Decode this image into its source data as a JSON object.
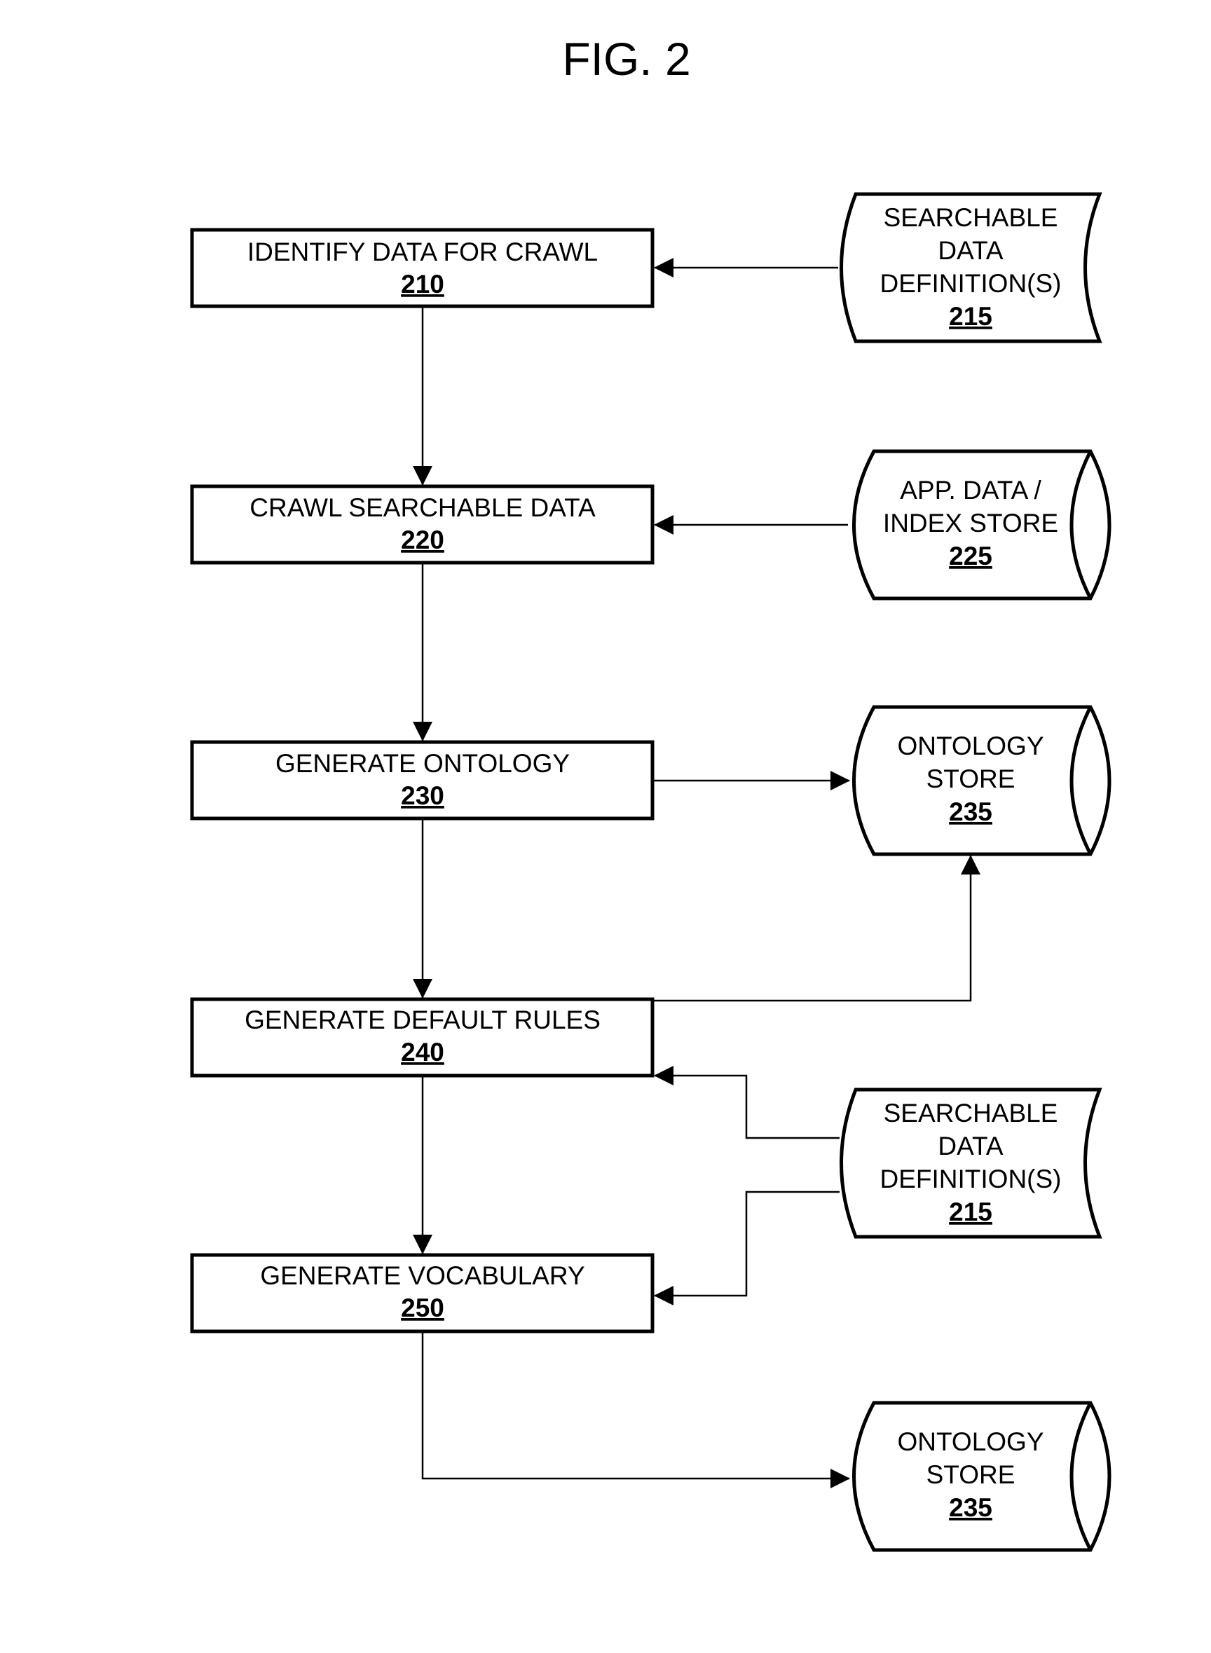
{
  "figure": {
    "title": "FIG. 2"
  },
  "steps": [
    {
      "id": "210",
      "label": "IDENTIFY DATA FOR CRAWL",
      "ref": "210"
    },
    {
      "id": "220",
      "label": "CRAWL SEARCHABLE DATA",
      "ref": "220"
    },
    {
      "id": "230",
      "label": "GENERATE ONTOLOGY",
      "ref": "230"
    },
    {
      "id": "240",
      "label": "GENERATE DEFAULT RULES",
      "ref": "240"
    },
    {
      "id": "250",
      "label": "GENERATE VOCABULARY",
      "ref": "250"
    }
  ],
  "data_sources": [
    {
      "shape": "stored-data",
      "lines": [
        "SEARCHABLE",
        "DATA",
        "DEFINITION(S)"
      ],
      "ref": "215"
    },
    {
      "shape": "cylinder",
      "lines": [
        "APP. DATA /",
        "INDEX STORE"
      ],
      "ref": "225"
    },
    {
      "shape": "cylinder",
      "lines": [
        "ONTOLOGY",
        "STORE"
      ],
      "ref": "235"
    },
    {
      "shape": "stored-data",
      "lines": [
        "SEARCHABLE",
        "DATA",
        "DEFINITION(S)"
      ],
      "ref": "215"
    },
    {
      "shape": "cylinder",
      "lines": [
        "ONTOLOGY",
        "STORE"
      ],
      "ref": "235"
    }
  ],
  "connections": [
    {
      "from": "215",
      "to": "210"
    },
    {
      "from": "210",
      "to": "220"
    },
    {
      "from": "225",
      "to": "220"
    },
    {
      "from": "220",
      "to": "230"
    },
    {
      "from": "230",
      "to": "235"
    },
    {
      "from": "230",
      "to": "240"
    },
    {
      "from": "240",
      "to": "235"
    },
    {
      "from": "215",
      "to": "240"
    },
    {
      "from": "215",
      "to": "250"
    },
    {
      "from": "240",
      "to": "250"
    },
    {
      "from": "250",
      "to": "235"
    }
  ]
}
